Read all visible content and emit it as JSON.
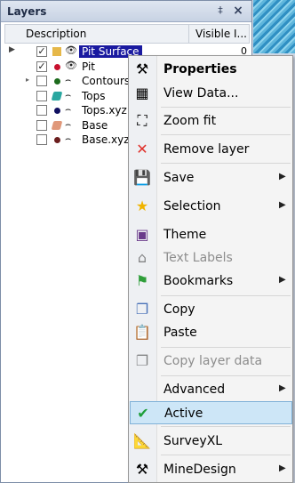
{
  "panel": {
    "title": "Layers",
    "pin_glyph": "‡",
    "close_glyph": "×",
    "columns": {
      "description": "Description",
      "visible": "Visible I..."
    }
  },
  "layers": [
    {
      "label": "Pit Surface",
      "checked": true,
      "icon": "folder-icon",
      "color": "#e6b84a",
      "visible": "0",
      "selected": true
    },
    {
      "label": "Pit",
      "checked": true,
      "icon": "point-icon",
      "color": "#c8102e",
      "visible": ""
    },
    {
      "label": "Contours",
      "checked": false,
      "icon": "point-icon",
      "color": "#1d6b1d",
      "visible": ""
    },
    {
      "label": "Tops",
      "checked": false,
      "icon": "surface-icon",
      "color": "#2aa7a0",
      "visible": ""
    },
    {
      "label": "Tops.xyz",
      "checked": false,
      "icon": "point-icon",
      "color": "#101060",
      "visible": ""
    },
    {
      "label": "Base",
      "checked": false,
      "icon": "surface-icon",
      "color": "#e0987a",
      "visible": ""
    },
    {
      "label": "Base.xyz",
      "checked": false,
      "icon": "point-icon",
      "color": "#6b1e1e",
      "visible": ""
    }
  ],
  "glyphs": {
    "check": "✓",
    "eye": "👁",
    "closed_eye": "⌢",
    "expander": "▸",
    "current_row": "▶",
    "submenu": "▶"
  },
  "menu": {
    "items": [
      {
        "label": "Properties",
        "icon": "tools-icon",
        "glyph": "⚒",
        "bold": true
      },
      {
        "label": "View Data...",
        "icon": "table-icon",
        "glyph": "▦"
      },
      {
        "label": "Zoom fit",
        "icon": "zoom-fit-icon",
        "glyph": "⛶"
      },
      {
        "label": "Remove layer",
        "icon": "remove-icon",
        "glyph": "✕"
      },
      {
        "label": "Save",
        "icon": "save-icon",
        "glyph": "💾",
        "submenu": true
      },
      {
        "label": "Selection",
        "icon": "star-icon",
        "glyph": "★",
        "submenu": true
      },
      {
        "label": "Theme",
        "icon": "theme-icon",
        "glyph": "▣"
      },
      {
        "label": "Text Labels",
        "icon": "tag-icon",
        "glyph": "⌂",
        "disabled": true
      },
      {
        "label": "Bookmarks",
        "icon": "bookmark-icon",
        "glyph": "⚑",
        "submenu": true
      },
      {
        "label": "Copy",
        "icon": "copy-icon",
        "glyph": "❐"
      },
      {
        "label": "Paste",
        "icon": "paste-icon",
        "glyph": "📋"
      },
      {
        "label": "Copy layer data",
        "icon": "copy-data-icon",
        "glyph": "❐",
        "disabled": true
      },
      {
        "label": "Advanced",
        "icon": "",
        "glyph": "",
        "submenu": true
      },
      {
        "label": "Active",
        "icon": "check-icon",
        "glyph": "✔",
        "highlighted": true
      },
      {
        "label": "SurveyXL",
        "icon": "survey-icon",
        "glyph": "📐"
      },
      {
        "label": "MineDesign",
        "icon": "pickaxe-icon",
        "glyph": "⚒",
        "submenu": true
      }
    ]
  },
  "colors": {
    "selection": "#1a1aa0",
    "active_highlight": "#cde6f7",
    "check_green": "#1e9e3a",
    "remove_red": "#e0302a",
    "star_gold": "#f0b400"
  }
}
